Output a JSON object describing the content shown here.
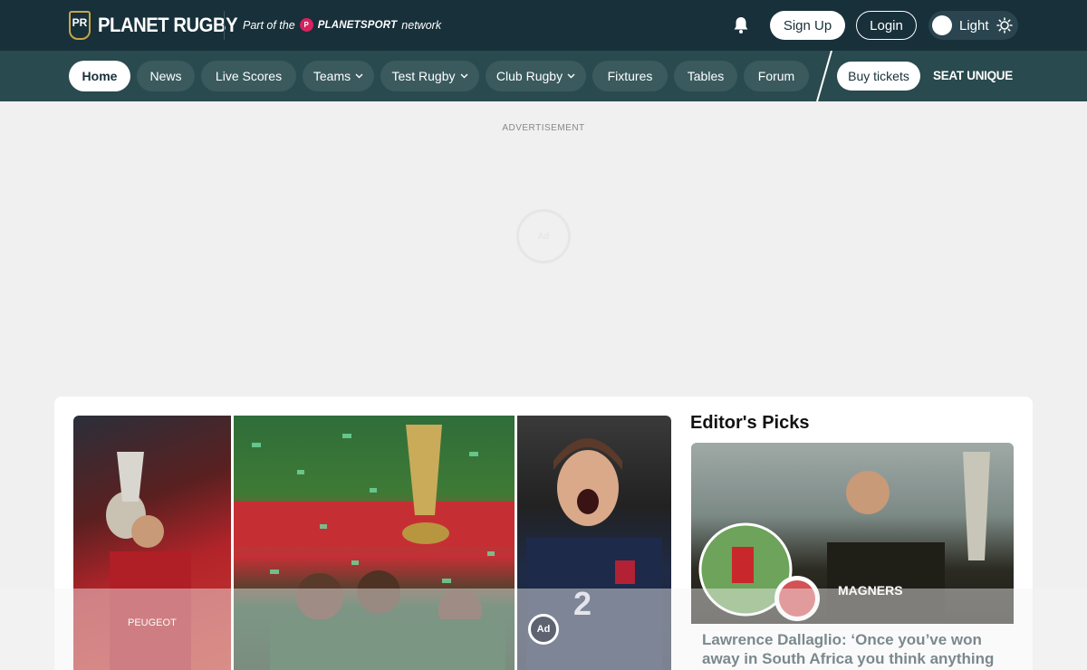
{
  "header": {
    "logo_badge": "PR",
    "logo_text": "PLANET RUGBY",
    "network_prefix": "Part of the",
    "network_brand": "PLANETSPORT",
    "network_suffix": "network",
    "signup_label": "Sign Up",
    "login_label": "Login",
    "theme_label": "Light"
  },
  "nav": {
    "items": [
      {
        "label": "Home"
      },
      {
        "label": "News"
      },
      {
        "label": "Live Scores"
      },
      {
        "label": "Teams"
      },
      {
        "label": "Test Rugby"
      },
      {
        "label": "Club Rugby"
      },
      {
        "label": "Fixtures"
      },
      {
        "label": "Tables"
      },
      {
        "label": "Forum"
      }
    ],
    "tickets_label": "Buy tickets",
    "partner_label": "SEAT UNIQUE"
  },
  "ad": {
    "label": "ADVERTISEMENT",
    "spinner_text": "Ad",
    "badge_text": "Ad"
  },
  "editors_picks": {
    "title": "Editor's Picks",
    "items": [
      {
        "headline": "Lawrence Dallaglio: ‘Once you’ve won away in South Africa you think anything"
      }
    ]
  },
  "colors": {
    "topbar": "#17303a",
    "navbar": "#294a4e",
    "accent": "#d6235f"
  }
}
